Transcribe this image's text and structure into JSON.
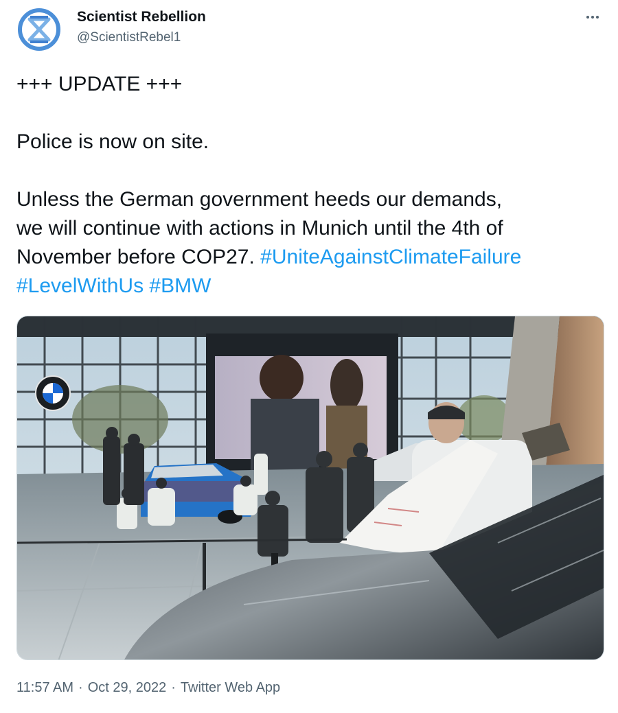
{
  "author": {
    "display_name": "Scientist Rebellion",
    "handle": "@ScientistRebel1",
    "avatar_icon": "extinction-hourglass-logo-icon"
  },
  "menu": {
    "icon": "more-horizontal-icon"
  },
  "tweet": {
    "line1": "+++ UPDATE +++",
    "line2": "Police is now on site.",
    "line3a": "Unless the German government heeds our demands,",
    "line3b": "we will continue with actions in Munich until the 4th of",
    "line3c": "November before COP27. ",
    "hashtag1": "#UniteAgainstClimateFailure",
    "hashtag2": "#LevelWithUs",
    "hashtag3": "#BMW"
  },
  "media": {
    "description": "photo",
    "logo_icon": "bmw-logo-icon"
  },
  "meta": {
    "time": "11:57 AM",
    "separator": "·",
    "date": "Oct 29, 2022",
    "source": "Twitter Web App"
  },
  "colors": {
    "link": "#1d9bf0",
    "text": "#0f1419",
    "secondary": "#536471"
  }
}
